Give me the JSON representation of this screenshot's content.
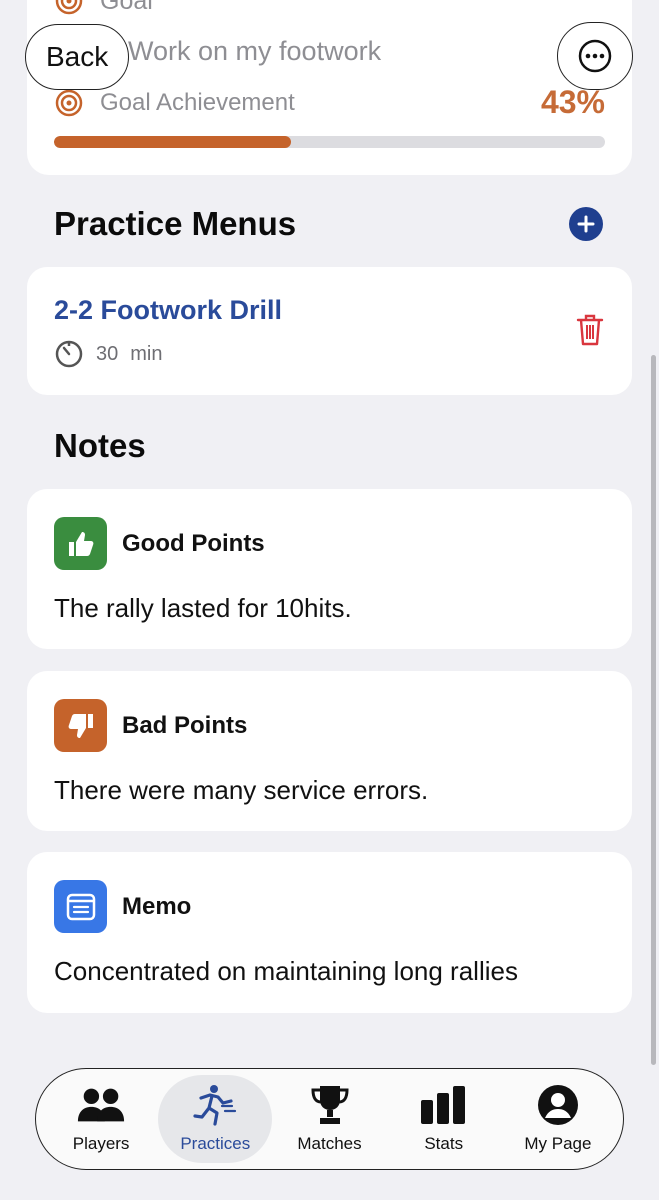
{
  "goal": {
    "heading": "Goal",
    "text": "Work on my footwork",
    "achievement_label": "Goal Achievement",
    "achievement_value": "43%",
    "progress": 0.43
  },
  "nav": {
    "back_label": "Back"
  },
  "practice_menus": {
    "title": "Practice Menus",
    "items": [
      {
        "name": "2-2 Footwork Drill",
        "duration": "30",
        "unit": "min"
      }
    ]
  },
  "notes": {
    "title": "Notes",
    "good": {
      "label": "Good Points",
      "text": "The rally lasted for 10hits.",
      "color": "#3a8d3f"
    },
    "bad": {
      "label": "Bad Points",
      "text": "There were many service errors.",
      "color": "#c5632b"
    },
    "memo": {
      "label": "Memo",
      "text": "Concentrated on maintaining long rallies",
      "color": "#3877e6"
    }
  },
  "tabbar": {
    "items": [
      {
        "label": "Players",
        "icon": "people-icon"
      },
      {
        "label": "Practices",
        "icon": "running-person-icon",
        "active": true
      },
      {
        "label": "Matches",
        "icon": "trophy-icon"
      },
      {
        "label": "Stats",
        "icon": "bar-chart-icon"
      },
      {
        "label": "My Page",
        "icon": "person-circle-icon"
      }
    ]
  }
}
